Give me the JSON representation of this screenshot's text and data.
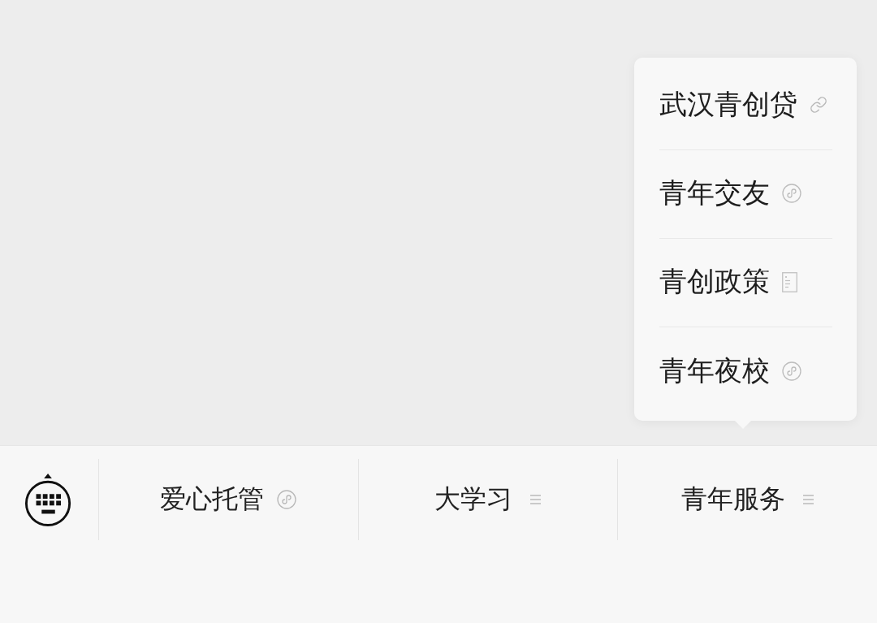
{
  "submenu_popup": {
    "items": [
      {
        "label": "武汉青创贷",
        "kind": "link"
      },
      {
        "label": "青年交友",
        "kind": "mini_program"
      },
      {
        "label": "青创政策",
        "kind": "article"
      },
      {
        "label": "青年夜校",
        "kind": "mini_program"
      }
    ]
  },
  "bottom_menu": {
    "items": [
      {
        "label": "爱心托管",
        "kind": "mini_program"
      },
      {
        "label": "大学习",
        "kind": "submenu"
      },
      {
        "label": "青年服务",
        "kind": "submenu"
      }
    ]
  }
}
